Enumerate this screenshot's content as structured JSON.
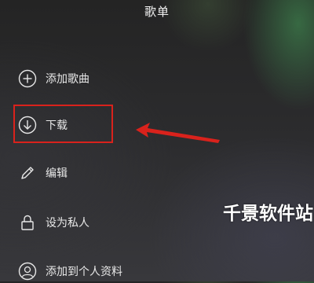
{
  "sheet": {
    "title": "歌单"
  },
  "menu": {
    "items": [
      {
        "label": "添加歌曲",
        "icon": "plus-circle-icon"
      },
      {
        "label": "下载",
        "icon": "download-circle-icon"
      },
      {
        "label": "编辑",
        "icon": "pencil-icon"
      },
      {
        "label": "设为私人",
        "icon": "lock-icon"
      },
      {
        "label": "添加到个人资料",
        "icon": "user-circle-icon"
      }
    ]
  },
  "annotation": {
    "highlight_color": "#d9221c",
    "highlighted_item": "下载"
  },
  "watermark": {
    "text": "千景软件站"
  }
}
